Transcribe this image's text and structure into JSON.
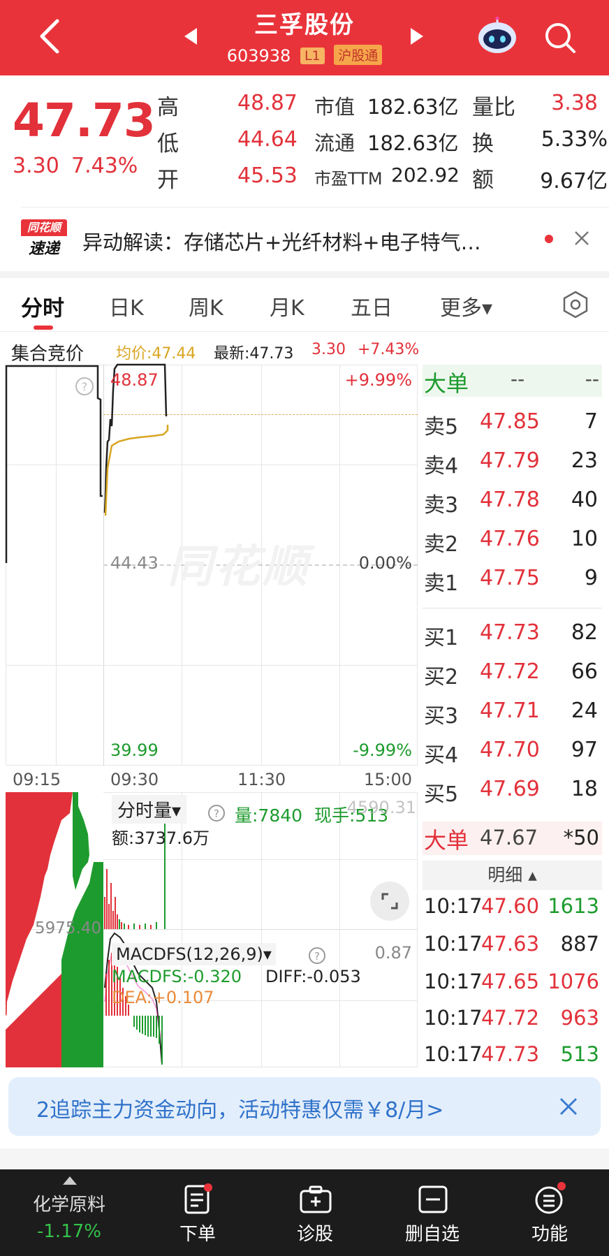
{
  "header": {
    "title": "三孚股份",
    "code": "603938",
    "badge_level": "L1",
    "badge_connect": "沪股通"
  },
  "quote": {
    "price": "47.73",
    "change": "3.30",
    "change_pct": "7.43%",
    "stats": [
      {
        "label": "高",
        "value": "48.87"
      },
      {
        "label": "低",
        "value": "44.64"
      },
      {
        "label": "开",
        "value": "45.53"
      }
    ],
    "stats_mid": [
      {
        "label": "市值",
        "value": "182.63亿"
      },
      {
        "label": "流通",
        "value": "182.63亿"
      },
      {
        "label": "市盈TTM",
        "value": "202.92"
      }
    ],
    "stats_right": [
      {
        "label": "量比",
        "value": "3.38"
      },
      {
        "label": "换",
        "value": "5.33%"
      },
      {
        "label": "额",
        "value": "9.67亿"
      }
    ]
  },
  "news": {
    "logo_top": "同花顺",
    "logo_bottom": "速递",
    "text": "异动解读：存储芯片+光纤材料+电子特气…"
  },
  "tabs": [
    "分时",
    "日K",
    "周K",
    "月K",
    "五日",
    "更多▾"
  ],
  "chart_header": {
    "auction": "集合竞价",
    "avg": "均价:47.44",
    "latest": "最新:47.73",
    "chg": "3.30",
    "chg_pct": "+7.43%"
  },
  "chart_labels": {
    "top_price": "48.87",
    "top_pct": "+9.99%",
    "mid_price": "44.43",
    "mid_pct": "0.00%",
    "bottom_price": "39.99",
    "bottom_pct": "-9.99%",
    "time_1": "09:15",
    "time_2": "09:30",
    "time_3": "11:30",
    "time_4": "15:00",
    "watermark": "同花顺"
  },
  "volume_panel": {
    "selector": "分时量▾",
    "vol": "量:7840",
    "now": "现手:513",
    "amount": "额:3737.6万",
    "left_value": "5975.40",
    "right_value": "4590.31"
  },
  "macd_panel": {
    "selector": "MACDFS(12,26,9)▾",
    "macdfs": "MACDFS:-0.320",
    "diff": "DIFF:-0.053",
    "dea": "DEA:+0.107",
    "right_value": "0.87"
  },
  "order_book": {
    "big_label": "大单",
    "big_dash1": "--",
    "big_dash2": "--",
    "asks": [
      {
        "label": "卖5",
        "price": "47.85",
        "vol": "7"
      },
      {
        "label": "卖4",
        "price": "47.79",
        "vol": "23"
      },
      {
        "label": "卖3",
        "price": "47.78",
        "vol": "40"
      },
      {
        "label": "卖2",
        "price": "47.76",
        "vol": "10"
      },
      {
        "label": "卖1",
        "price": "47.75",
        "vol": "9"
      }
    ],
    "bids": [
      {
        "label": "买1",
        "price": "47.73",
        "vol": "82"
      },
      {
        "label": "买2",
        "price": "47.72",
        "vol": "66"
      },
      {
        "label": "买3",
        "price": "47.71",
        "vol": "24"
      },
      {
        "label": "买4",
        "price": "47.70",
        "vol": "97"
      },
      {
        "label": "买5",
        "price": "47.69",
        "vol": "18"
      }
    ],
    "big_order": {
      "label": "大单",
      "price": "47.67",
      "vol": "*50"
    },
    "detail_label": "明细 ▴",
    "ticks": [
      {
        "time": "10:17",
        "price": "47.60",
        "vol": "1613",
        "side": "buy"
      },
      {
        "time": "10:17",
        "price": "47.63",
        "vol": "887",
        "side": "sell"
      },
      {
        "time": "10:17",
        "price": "47.65",
        "vol": "1076",
        "side": "sell"
      },
      {
        "time": "10:17",
        "price": "47.72",
        "vol": "963",
        "side": "sell"
      },
      {
        "time": "10:17",
        "price": "47.73",
        "vol": "513",
        "side": "buy"
      }
    ]
  },
  "promo": {
    "text": "2追踪主力资金动向，活动特惠仅需￥8/月>"
  },
  "bottom_nav": {
    "sector_name": "化学原料",
    "sector_pct": "-1.17%",
    "items": [
      "下单",
      "诊股",
      "删自选",
      "功能"
    ]
  },
  "colors": {
    "brand_red": "#e9333a",
    "price_red": "#e2313a",
    "price_green": "#1e9b2e",
    "avg_line": "#d9a521",
    "promo_bg": "#e3eefc",
    "nav_bg": "#1c1c1c"
  }
}
